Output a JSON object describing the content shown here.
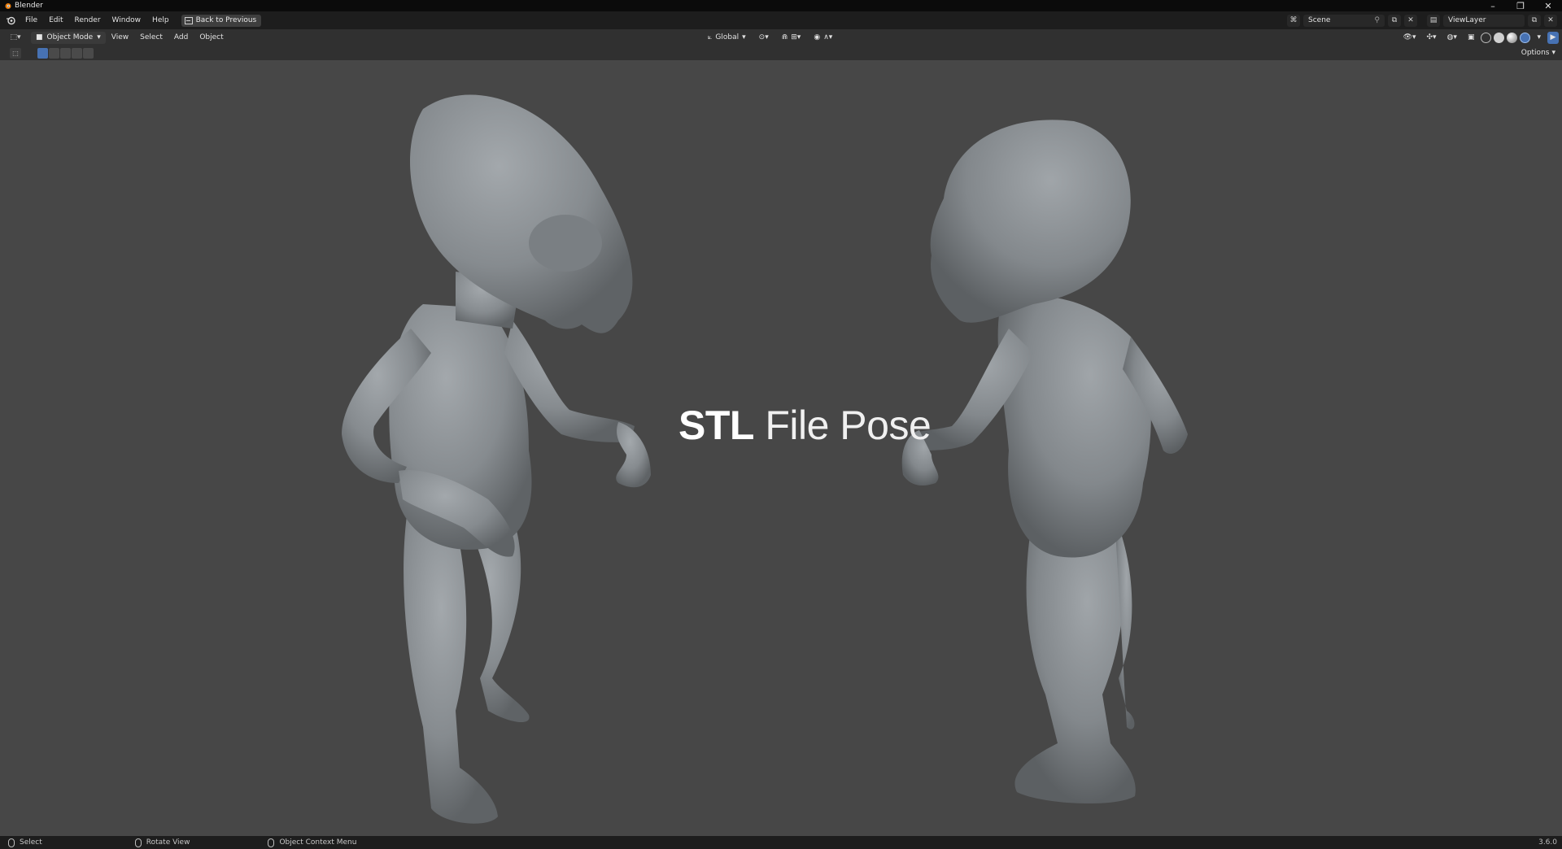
{
  "window": {
    "title": "Blender",
    "controls": [
      "minimize-icon",
      "maximize-icon",
      "close-icon"
    ]
  },
  "topbar": {
    "menus": [
      "File",
      "Edit",
      "Render",
      "Window",
      "Help"
    ],
    "back_button": "Back to Previous",
    "scene": "Scene",
    "view_layer": "ViewLayer"
  },
  "viewport_header": {
    "mode": "Object Mode",
    "menus": [
      "View",
      "Select",
      "Add",
      "Object"
    ],
    "transform_orientation": "Global"
  },
  "tool_header": {
    "options_label": "Options"
  },
  "viewport": {
    "headline_bold": "STL",
    "headline_light": "File Pose",
    "background_color": "#474747",
    "model_color": "#8a8f93"
  },
  "statusbar": {
    "items": [
      "Select",
      "Rotate View",
      "Object Context Menu"
    ],
    "version": "3.6.0"
  },
  "colors": {
    "accent": "#4772b3",
    "header_bg": "#303030",
    "topbar_bg": "#1d1d1d"
  }
}
